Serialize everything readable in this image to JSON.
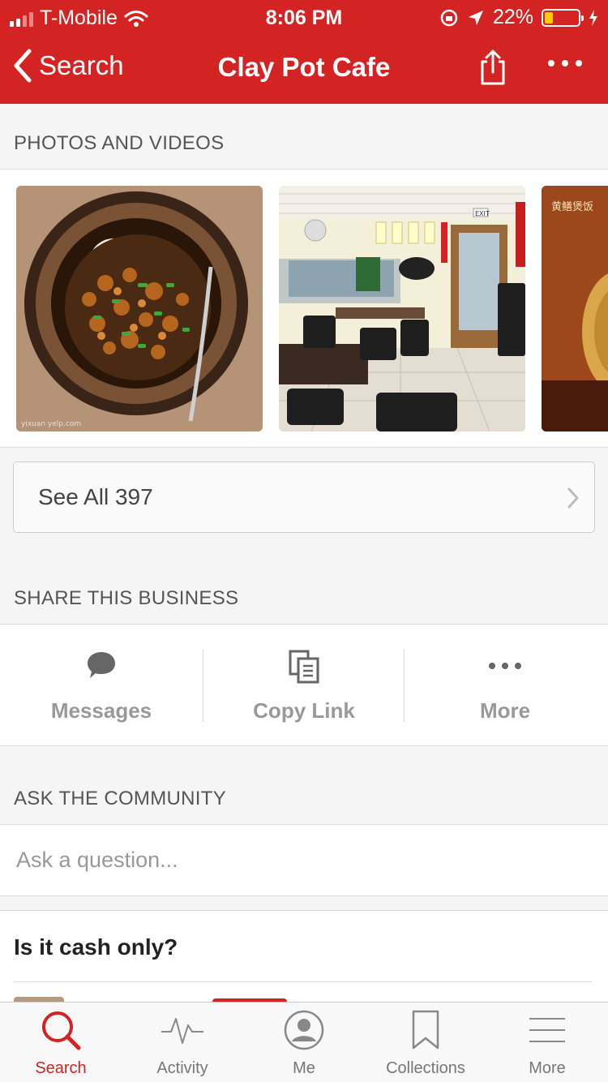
{
  "status_bar": {
    "carrier": "T-Mobile",
    "time": "8:06 PM",
    "battery": "22%"
  },
  "nav": {
    "back_label": "Search",
    "title": "Clay Pot Cafe"
  },
  "photos": {
    "section_title": "PHOTOS AND VIDEOS",
    "watermark": "yixuan yelp.com",
    "sign_text": "黄鳝煲饭",
    "exit_sign": "EXIT",
    "see_all_label": "See All 397"
  },
  "share": {
    "section_title": "SHARE THIS BUSINESS",
    "items": [
      {
        "label": "Messages",
        "icon": "chat-bubble-icon"
      },
      {
        "label": "Copy Link",
        "icon": "copy-icon"
      },
      {
        "label": "More",
        "icon": "ellipsis-icon"
      }
    ]
  },
  "community": {
    "section_title": "ASK THE COMMUNITY",
    "placeholder": "Ask a question...",
    "question": "Is it cash only?"
  },
  "tabbar": {
    "items": [
      {
        "label": "Search",
        "icon": "search-icon",
        "active": true
      },
      {
        "label": "Activity",
        "icon": "activity-icon",
        "active": false
      },
      {
        "label": "Me",
        "icon": "profile-icon",
        "active": false
      },
      {
        "label": "Collections",
        "icon": "bookmark-icon",
        "active": false
      },
      {
        "label": "More",
        "icon": "menu-icon",
        "active": false
      }
    ]
  },
  "colors": {
    "brand_red": "#d32323",
    "battery_low": "#ffcc00"
  }
}
